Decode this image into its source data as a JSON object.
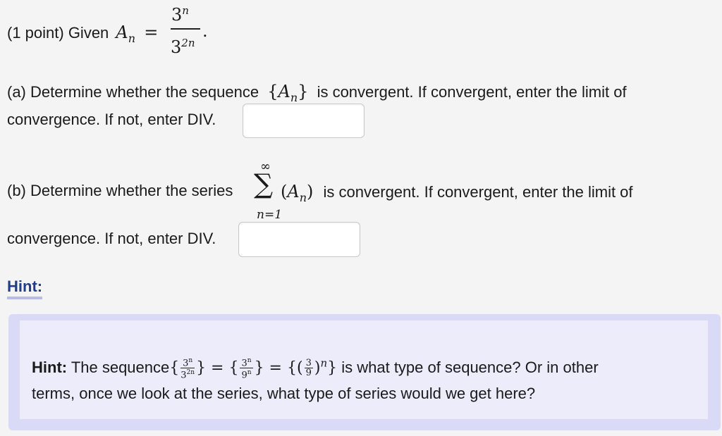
{
  "question": {
    "points": "(1 point) Given",
    "var": "A",
    "sub": "n",
    "equals": "=",
    "num_base": "3",
    "num_exp": "n",
    "den_base": "3",
    "den_exp": "2n",
    "period": "."
  },
  "part_a": {
    "line1_start": "(a) Determine whether the sequence",
    "line1_end": "is convergent. If convergent, enter the limit of",
    "line2": "convergence. If not, enter DIV.",
    "answer_value": ""
  },
  "part_b": {
    "line1_start": "(b) Determine whether the series",
    "sum_top": "∞",
    "sum_bottom": "n=1",
    "line1_end": "is convergent. If convergent, enter the limit of",
    "line2": "convergence. If not, enter DIV.",
    "answer_value": ""
  },
  "hint": {
    "label": "Hint:",
    "bold": "Hint:",
    "text1": "The sequence",
    "text2": "is what type of sequence? Or in other",
    "line2": "terms, once we look at the series, what type of series would we get here?"
  }
}
